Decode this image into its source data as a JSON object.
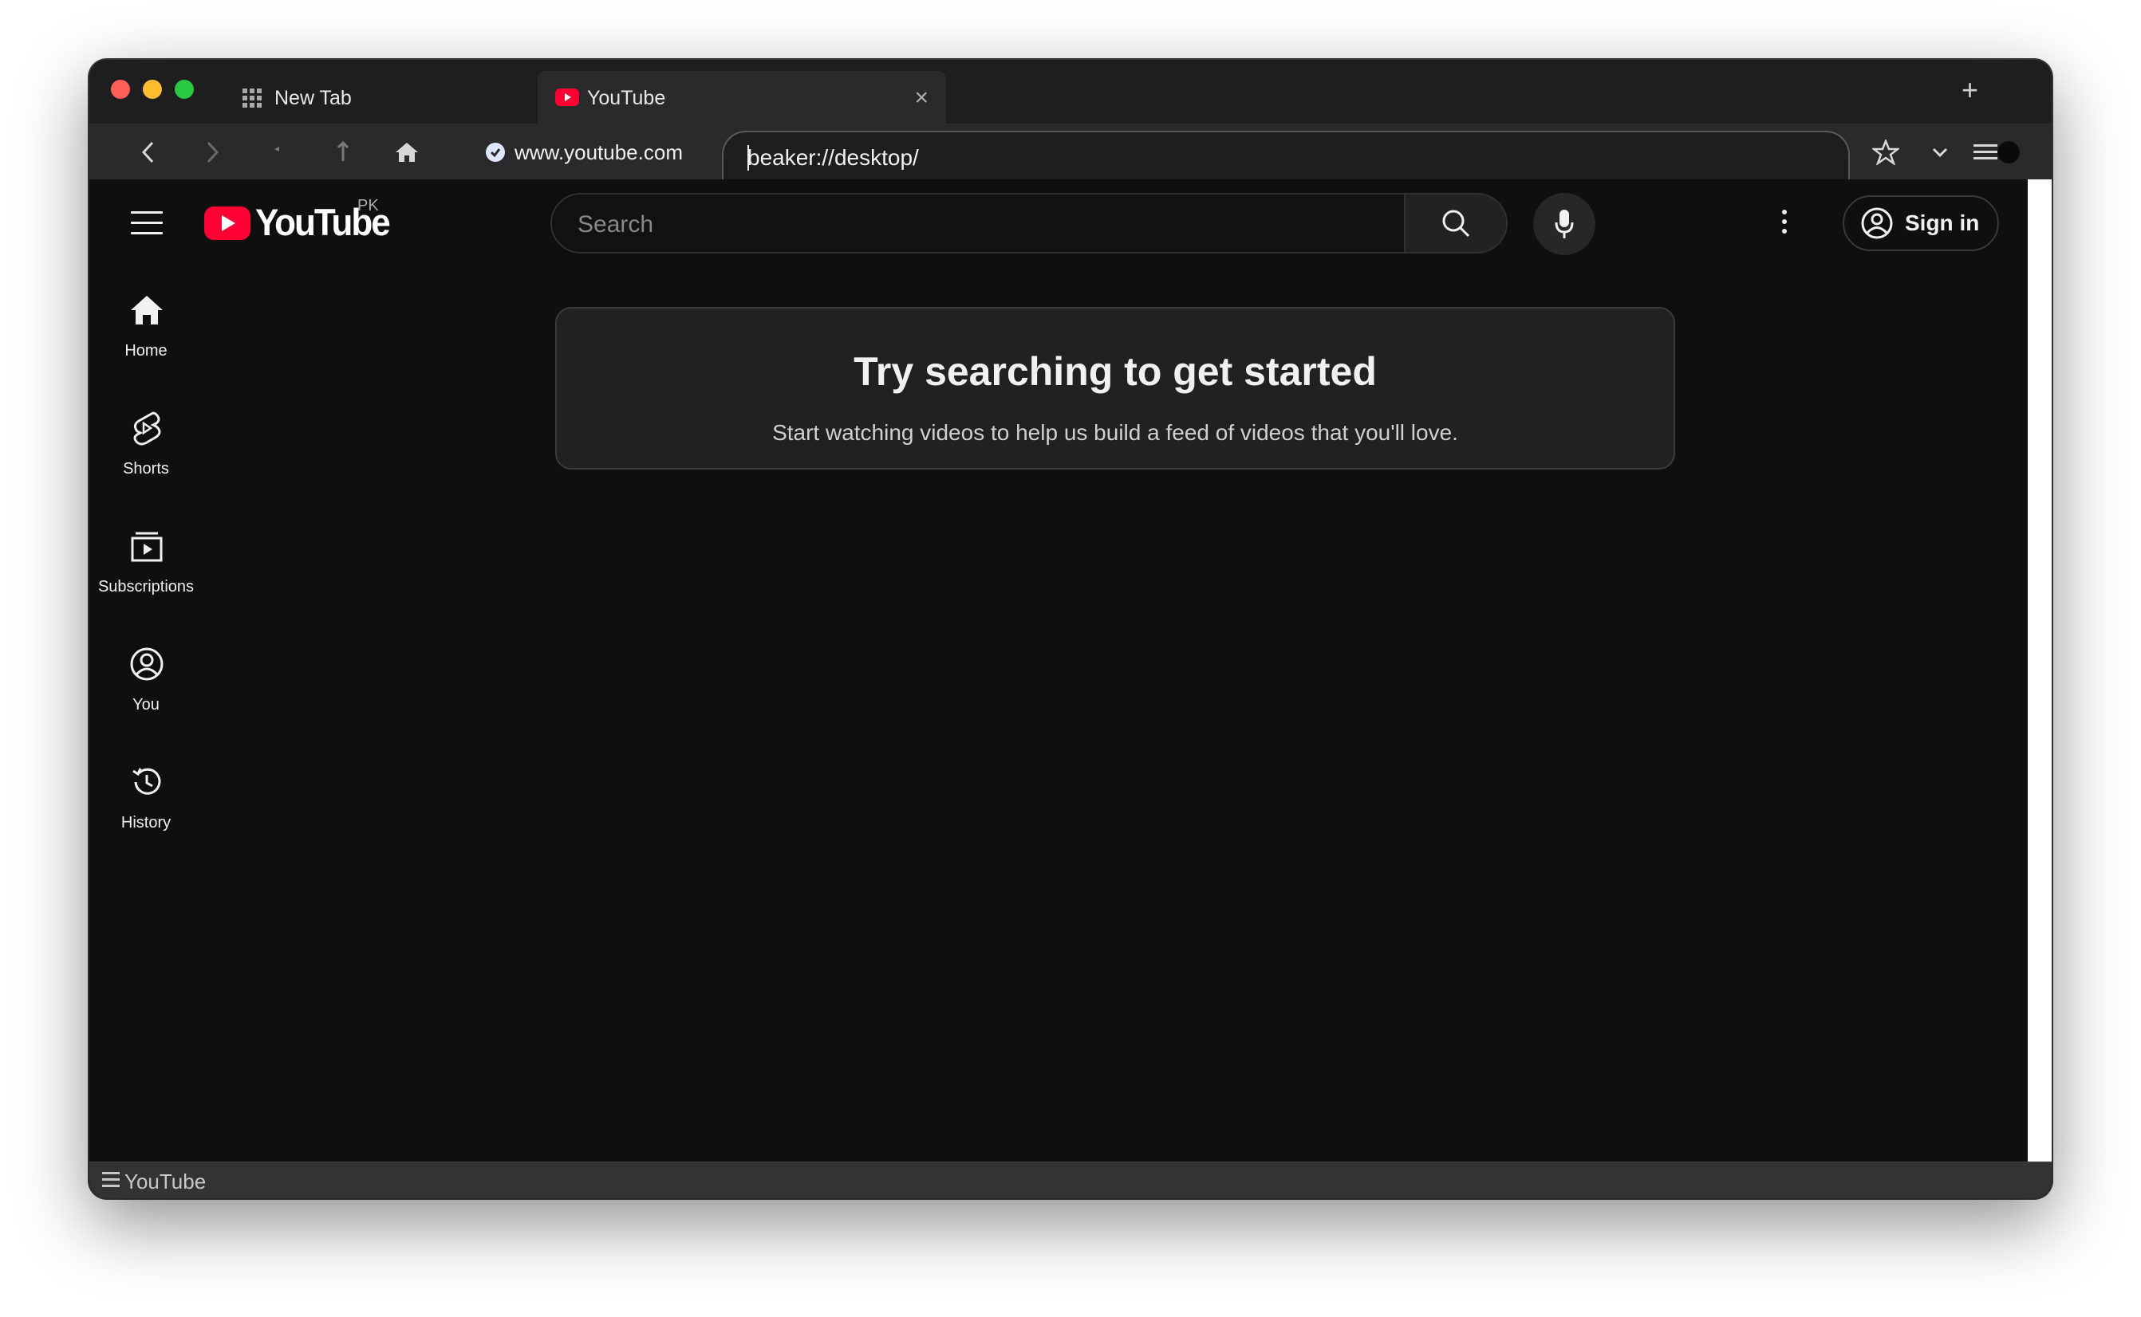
{
  "browser": {
    "tabs": [
      {
        "label": "New Tab",
        "icon": "grid-icon",
        "active": false
      },
      {
        "label": "YouTube",
        "icon": "youtube-favicon-icon",
        "active": true,
        "close": "×"
      }
    ],
    "new_tab_symbol": "+",
    "site_identity": "www.youtube.com",
    "url": "beaker://desktop/",
    "status_text": "YouTube"
  },
  "youtube": {
    "logo_text": "YouTube",
    "country_code": "PK",
    "search_placeholder": "Search",
    "sign_in_label": "Sign in",
    "sidebar": [
      {
        "label": "Home",
        "icon": "home-icon"
      },
      {
        "label": "Shorts",
        "icon": "shorts-icon"
      },
      {
        "label": "Subscriptions",
        "icon": "subscriptions-icon"
      },
      {
        "label": "You",
        "icon": "you-icon"
      },
      {
        "label": "History",
        "icon": "history-icon"
      }
    ],
    "empty_state": {
      "title": "Try searching to get started",
      "subtitle": "Start watching videos to help us build a feed of videos that you'll love."
    }
  },
  "colors": {
    "youtube_red": "#ff0033",
    "page_background": "#0f0f0f",
    "card_background": "#212121"
  }
}
